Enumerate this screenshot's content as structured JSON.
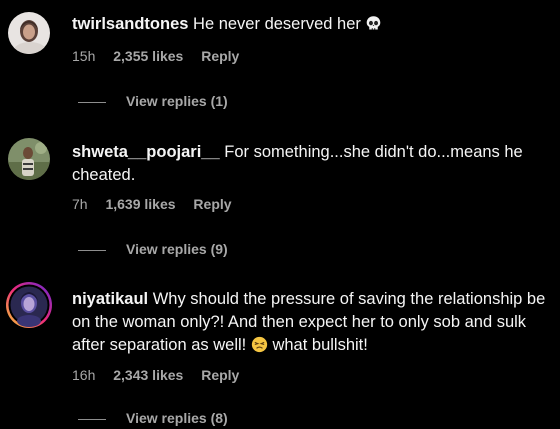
{
  "comments": [
    {
      "username": "twirlsandtones",
      "text": "He never deserved her",
      "emoji": "skull-icon",
      "time": "15h",
      "likes": "2,355 likes",
      "reply": "Reply",
      "view_replies": "View replies (1)"
    },
    {
      "username": "shweta__poojari__",
      "text": "For something...she didn't do...means he cheated.",
      "time": "7h",
      "likes": "1,639 likes",
      "reply": "Reply",
      "view_replies": "View replies (9)"
    },
    {
      "username": "niyatikaul",
      "text_before_emoji": "Why should the pressure of saving the relationship be on the woman only?! And then expect her to only sob and sulk after separation as well!",
      "emoji": "persevering-face-icon",
      "text_after_emoji": "what bullshit!",
      "time": "16h",
      "likes": "2,343 likes",
      "reply": "Reply",
      "view_replies": "View replies (8)"
    }
  ],
  "colors": {
    "background": "#000000",
    "primary_text": "#f5f5f5",
    "secondary_text": "#a8a8a8",
    "story_ring_start": "#f9ce34",
    "story_ring_mid": "#ee2a7b",
    "story_ring_end": "#6228d7"
  }
}
